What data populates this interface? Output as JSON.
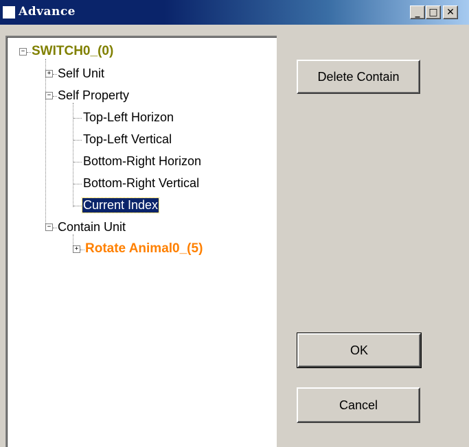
{
  "window": {
    "title": "Advance",
    "minimize_glyph": "_",
    "maximize_glyph": "□",
    "close_glyph": "✕"
  },
  "tree": {
    "root": {
      "label": "SWITCH0_(0)",
      "expander": "−"
    },
    "self_unit": {
      "label": "Self Unit",
      "expander": "+"
    },
    "self_property": {
      "label": "Self Property",
      "expander": "−",
      "children": [
        "Top-Left Horizon",
        "Top-Left Vertical",
        "Bottom-Right Horizon",
        "Bottom-Right Vertical",
        "Current Index"
      ]
    },
    "contain_unit": {
      "label": "Contain Unit",
      "expander": "−",
      "child": {
        "label": "Rotate Animal0_(5)",
        "expander": "+"
      }
    }
  },
  "buttons": {
    "delete_contain": "Delete Contain",
    "ok": "OK",
    "cancel": "Cancel"
  },
  "colors": {
    "root_node": "#808000",
    "contained_node": "#ff8000",
    "selection": "#0a246a"
  }
}
